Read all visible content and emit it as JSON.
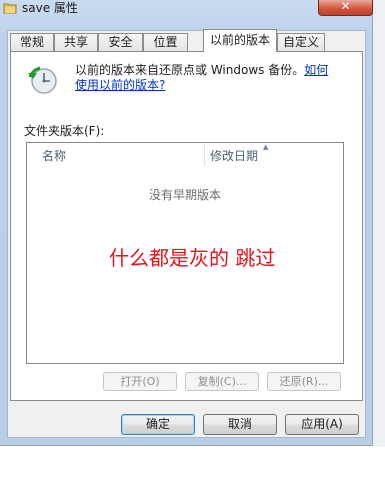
{
  "window": {
    "title": "save 属性",
    "close_label": "✕",
    "icon": "folder-icon"
  },
  "tabs": [
    {
      "label": "常规"
    },
    {
      "label": "共享"
    },
    {
      "label": "安全"
    },
    {
      "label": "位置"
    },
    {
      "label": "以前的版本",
      "active": true
    },
    {
      "label": "自定义"
    }
  ],
  "page": {
    "restore_icon": "system-restore-icon",
    "description_text": "以前的版本来自还原点或 Windows 备份。",
    "description_link": "如何使用以前的版本?",
    "folder_versions_label": "文件夹版本(F):",
    "columns": [
      "名称",
      "修改日期"
    ],
    "empty_text": "没有早期版本",
    "annotation_text": "什么都是灰的 跳过",
    "buttons": {
      "open": "打开(O)",
      "copy": "复制(C)...",
      "restore": "还原(R)..."
    }
  },
  "dialog_buttons": {
    "ok": "确定",
    "cancel": "取消",
    "apply": "应用(A)"
  },
  "colors": {
    "link": "#0033cc",
    "annotation": "#e8121a"
  }
}
